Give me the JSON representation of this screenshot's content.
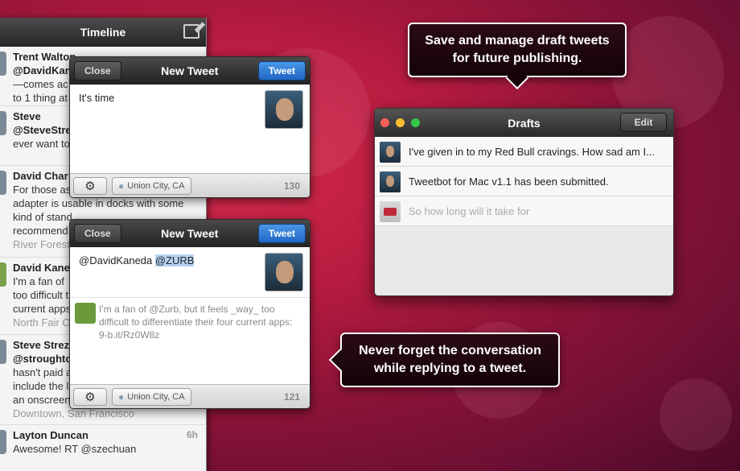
{
  "timeline": {
    "title": "Timeline",
    "items": [
      {
        "name": "Trent Walton",
        "handle": "@DavidKan",
        "lines": [
          "—comes ac",
          "to 1 thing at"
        ],
        "location": "",
        "time": ""
      },
      {
        "name": "Steve",
        "handle": "@SteveStre",
        "lines": [
          "ever want to"
        ],
        "location": "",
        "time": ""
      },
      {
        "name": "David Char",
        "handle": "",
        "lines": [
          "For those as",
          "adapter is usable in docks with some",
          "kind of stand",
          "recommend"
        ],
        "location": "River Forest",
        "time": ""
      },
      {
        "name": "David Kane",
        "handle": "",
        "lines": [
          "I'm a fan of",
          "too difficult t",
          "current apps"
        ],
        "location": "North Fair C",
        "time": ""
      },
      {
        "name": "Steve Strez",
        "handle": "@stroughto",
        "lines": [
          "hasn't paid a",
          "include the l",
          "an onscreen keyboard?"
        ],
        "location": "Downtown, San Francisco",
        "time": ""
      },
      {
        "name": "Layton Duncan",
        "handle": "",
        "lines": [
          "Awesome! RT @szechuan"
        ],
        "location": "",
        "time": "6h"
      }
    ]
  },
  "compose1": {
    "close_label": "Close",
    "title": "New Tweet",
    "tweet_label": "Tweet",
    "text": "It's time",
    "location": "Union City, CA",
    "count": "130"
  },
  "compose2": {
    "close_label": "Close",
    "title": "New Tweet",
    "tweet_label": "Tweet",
    "text_prefix": "@DavidKaneda",
    "text_highlight": "@ZURB",
    "reply_text": "I'm a fan of @Zurb, but it feels _way_ too difficult to differentiate their four current apps: 9-b.it/Rz0W8z",
    "location": "Union City, CA",
    "count": "121"
  },
  "callouts": {
    "drafts": "Save and manage draft tweets for future publishing.",
    "conversation": "Never forget the conversation while replying to a tweet."
  },
  "drafts": {
    "title": "Drafts",
    "edit_label": "Edit",
    "items": [
      {
        "text": "I've given in to my Red Bull cravings. How sad am I..."
      },
      {
        "text": "Tweetbot for Mac v1.1 has been submitted."
      },
      {
        "text": "So how long will it take for"
      }
    ]
  },
  "colors": {
    "traffic_red": "#fc5f57",
    "traffic_yellow": "#fdbc2e",
    "traffic_green": "#33c748",
    "tweet_blue": "#2a78d6"
  }
}
